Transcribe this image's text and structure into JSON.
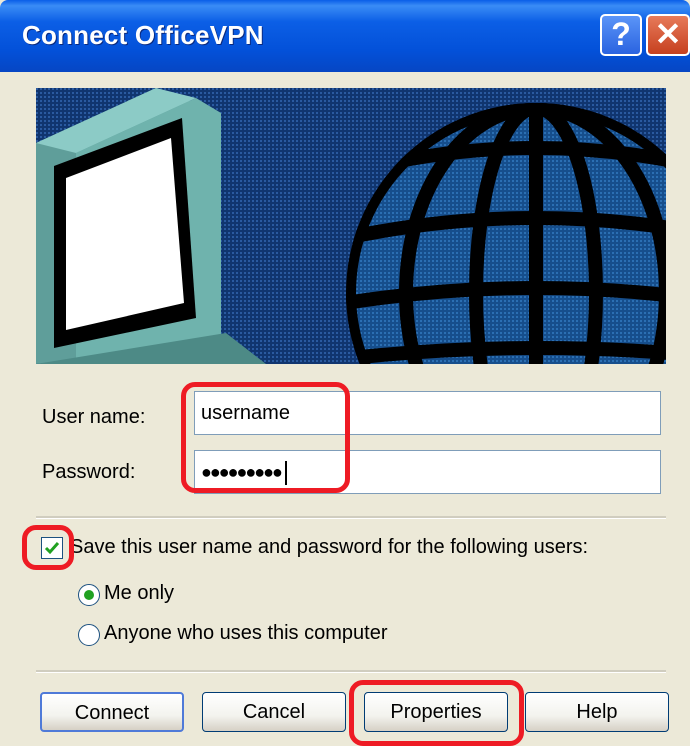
{
  "window": {
    "title": "Connect OfficeVPN"
  },
  "titlebar_buttons": {
    "help": "?",
    "close": "✕"
  },
  "form": {
    "username_label": "User name:",
    "username_value": "username",
    "password_label": "Password:",
    "password_value": "●●●●●●●●●",
    "save_label": "Save this user name and password for the following users:",
    "save_checked": true,
    "radio_me": "Me only",
    "radio_anyone": "Anyone who uses this computer",
    "selected_radio": "Me only"
  },
  "buttons": {
    "connect": "Connect",
    "cancel": "Cancel",
    "properties": "Properties",
    "help": "Help"
  },
  "colors": {
    "titlebar": "#0351d9",
    "dialog": "#ece9d8",
    "highlight": "#ee1b24",
    "banner_bg": "#0b2f66"
  }
}
